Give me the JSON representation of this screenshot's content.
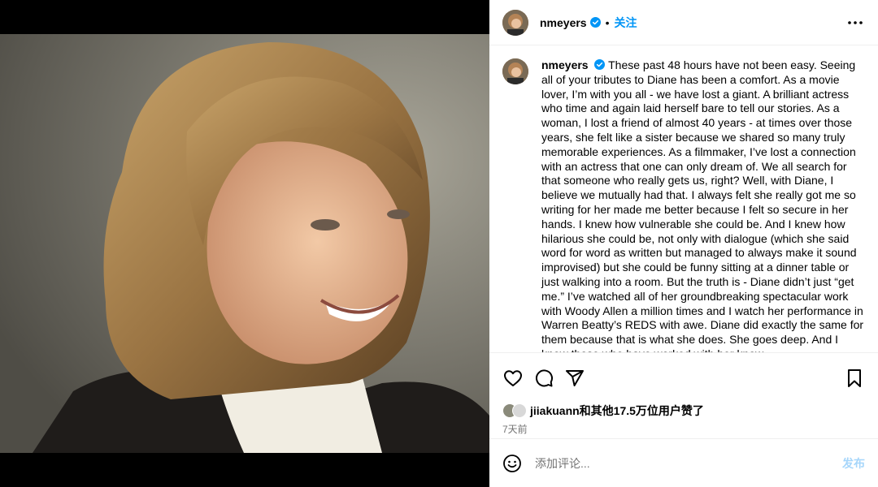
{
  "post": {
    "username": "nmeyers",
    "follow_label": "关注",
    "separator": "•"
  },
  "caption": {
    "username": "nmeyers",
    "text": "These past 48 hours have not been easy. Seeing all of your tributes to Diane has been a comfort. As a movie lover, I’m with you all - we have lost a giant. A brilliant actress who time and again laid herself bare to tell our stories. As a woman, I lost a friend of almost 40 years - at times over those years, she felt like a sister because we shared so many truly memorable experiences. As a filmmaker, I’ve lost a connection with an actress that one can only dream of. We all search for that someone who really gets us, right? Well, with Diane, I believe we mutually had that. I always felt she really got me so writing for her made me better because I felt so secure in her hands. I knew how vulnerable she could be. And I knew how hilarious she could be, not only with dialogue (which she said word for word as written but managed to always make it sound improvised) but she could be funny sitting at a dinner table or just walking into a room. But the truth is - Diane didn’t just “get me.” I’ve watched all of her groundbreaking spectacular work with Woody Allen a million times and I watch her performance in Warren Beatty’s REDS with awe. Diane did exactly the same for them because that is what she does. She goes deep. And I know those who have worked with her know"
  },
  "likes": {
    "text": "jiiakuann和其他17.5万位用户赞了"
  },
  "timestamp": "7天前",
  "comment": {
    "placeholder": "添加评论...",
    "post_label": "发布"
  },
  "icons": {
    "verified": "verified-badge-icon",
    "more": "more-options-icon",
    "like": "heart-icon",
    "comment": "comment-bubble-icon",
    "share": "paper-plane-icon",
    "save": "bookmark-icon",
    "emoji": "emoji-smiley-icon"
  },
  "colors": {
    "accent": "#0095f6",
    "post_disabled": "#a6d6fb",
    "muted": "#737373"
  }
}
